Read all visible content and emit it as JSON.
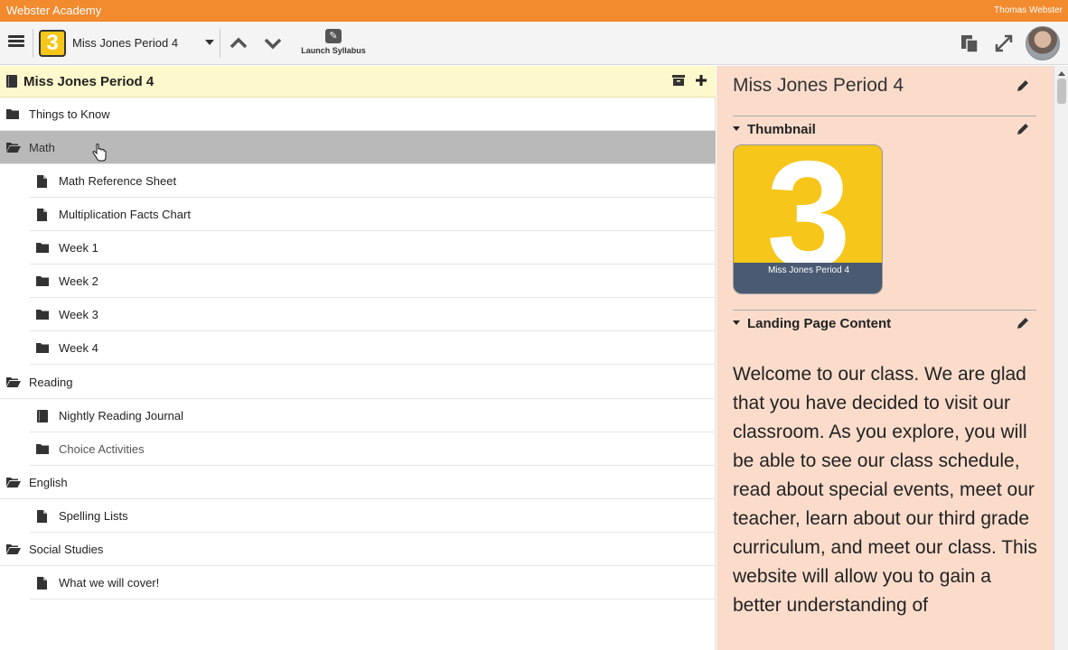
{
  "app": {
    "title": "Webster Academy",
    "user_name": "Thomas Webster",
    "brand_color": "#f28a2e"
  },
  "toolbar": {
    "class_badge": "3",
    "class_name": "Miss Jones Period 4",
    "launch_label": "Launch Syllabus",
    "icons": [
      "hamburger-menu-icon",
      "chevron-up-icon",
      "chevron-down-icon",
      "pencil-icon",
      "copy-icon",
      "expand-icon",
      "avatar"
    ]
  },
  "left_panel": {
    "title": "Miss Jones Period 4",
    "rows": [
      {
        "label": "Things to Know",
        "icon": "folder-icon"
      },
      {
        "label": "Math",
        "icon": "folder-open-icon",
        "selected": true
      },
      {
        "label": "Math Reference Sheet",
        "icon": "file-icon"
      },
      {
        "label": "Multiplication Facts Chart",
        "icon": "file-icon"
      },
      {
        "label": "Week 1",
        "icon": "folder-icon"
      },
      {
        "label": "Week 2",
        "icon": "folder-icon"
      },
      {
        "label": "Week 3",
        "icon": "folder-icon"
      },
      {
        "label": "Week 4",
        "icon": "folder-icon"
      },
      {
        "label": "Reading",
        "icon": "folder-open-icon"
      },
      {
        "label": "Nightly Reading Journal",
        "icon": "book-icon"
      },
      {
        "label": "Choice Activities",
        "icon": "folder-icon"
      },
      {
        "label": "English",
        "icon": "folder-open-icon"
      },
      {
        "label": "Spelling Lists",
        "icon": "file-icon"
      },
      {
        "label": "Social Studies",
        "icon": "folder-open-icon"
      },
      {
        "label": "What we will cover!",
        "icon": "file-icon"
      }
    ]
  },
  "right_panel": {
    "title": "Miss Jones Period 4",
    "thumbnail_heading": "Thumbnail",
    "thumbnail_digit": "3",
    "thumbnail_caption": "Miss Jones Period 4",
    "landing_heading": "Landing Page Content",
    "landing_text": "Welcome to our class.  We are glad that you have decided to visit our classroom.  As you explore, you will be able to see our class schedule, read about special events, meet our teacher, learn about our third grade curriculum, and meet our class.  This website will allow you to gain a better understanding of"
  }
}
